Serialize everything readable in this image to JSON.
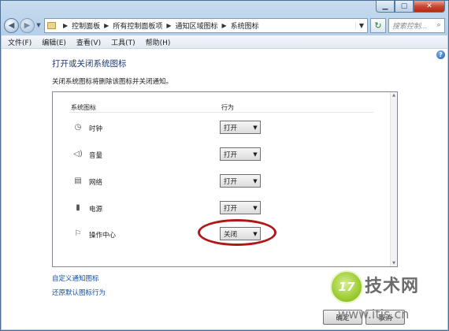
{
  "breadcrumb": [
    "控制面板",
    "所有控制面板项",
    "通知区域图标",
    "系统图标"
  ],
  "search": {
    "placeholder": "搜索控制..."
  },
  "menu": [
    "文件(F)",
    "编辑(E)",
    "查看(V)",
    "工具(T)",
    "帮助(H)"
  ],
  "page": {
    "title": "打开或关闭系统图标",
    "description": "关闭系统图标将删除该图标并关闭通知。"
  },
  "table": {
    "header_icon": "系统图标",
    "header_behavior": "行为",
    "rows": [
      {
        "icon": "clock-icon",
        "label": "时钟",
        "value": "打开"
      },
      {
        "icon": "volume-icon",
        "label": "音量",
        "value": "打开"
      },
      {
        "icon": "network-icon",
        "label": "网络",
        "value": "打开"
      },
      {
        "icon": "power-icon",
        "label": "电源",
        "value": "打开"
      },
      {
        "icon": "action-center-icon",
        "label": "操作中心",
        "value": "关闭"
      }
    ]
  },
  "links": {
    "customize": "自定义通知图标",
    "restore": "还原默认图标行为"
  },
  "buttons": {
    "ok": "确定",
    "cancel": "取消"
  },
  "watermark": {
    "badge": "17",
    "title": "技术网",
    "url": "www.itjs.cn"
  },
  "colors": {
    "link": "#0f4fa8",
    "highlight_ring": "#b01818",
    "title": "#1e3a6e"
  }
}
